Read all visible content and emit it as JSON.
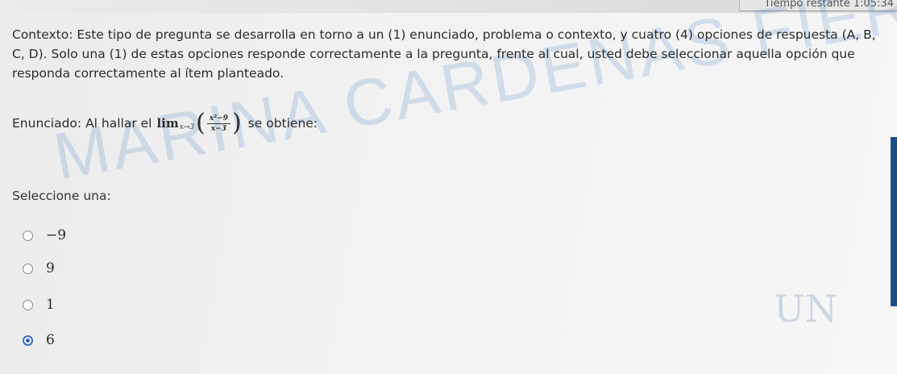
{
  "header": {
    "timer_text": "Tiempo restante 1:05:34"
  },
  "question": {
    "context": "Contexto: Este tipo de pregunta se desarrolla en torno a un (1) enunciado, problema o contexto, y cuatro (4) opciones de respuesta (A, B, C, D). Solo una (1) de estas opciones responde correctamente a la pregunta, frente al cual, usted debe seleccionar aquella opción que responda correctamente al ítem planteado.",
    "statement_prefix": "Enunciado: Al hallar el",
    "statement_suffix": "se obtiene:",
    "math": {
      "lim": "lim",
      "subscript": "x→3",
      "numerator": "x²−9",
      "denominator": "x−3"
    },
    "prompt": "Seleccione una:",
    "options": [
      {
        "label": "−9",
        "selected": false
      },
      {
        "label": "9",
        "selected": false
      },
      {
        "label": "1",
        "selected": false
      },
      {
        "label": "6",
        "selected": true
      }
    ]
  },
  "watermark": "MARINA CARDENAS FIERRO",
  "logo_text": "UN",
  "colors": {
    "radio_selected": "#2f62c0",
    "side_bar": "#1d4f86"
  }
}
